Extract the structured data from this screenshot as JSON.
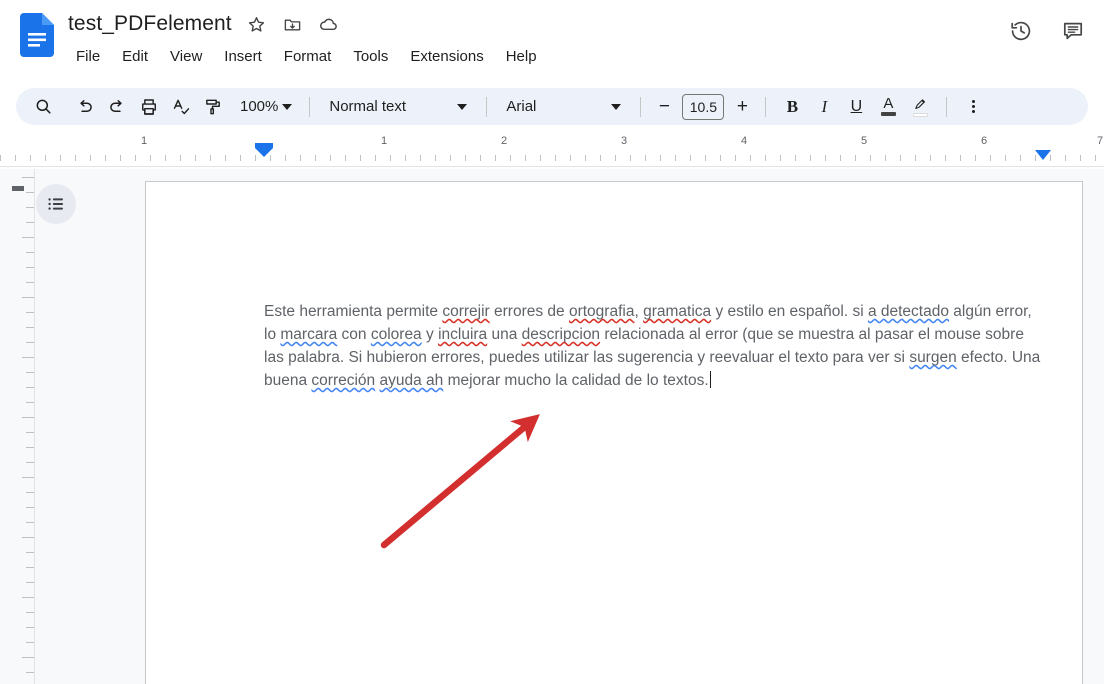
{
  "header": {
    "doc_title": "test_PDFelement",
    "logo_name": "google-docs-logo",
    "title_icons": [
      {
        "name": "star-icon",
        "label": "Star"
      },
      {
        "name": "move-to-folder-icon",
        "label": "Move"
      },
      {
        "name": "cloud-saved-icon",
        "label": "Saved to Drive"
      }
    ],
    "menu": [
      {
        "label": "File"
      },
      {
        "label": "Edit"
      },
      {
        "label": "View"
      },
      {
        "label": "Insert"
      },
      {
        "label": "Format"
      },
      {
        "label": "Tools"
      },
      {
        "label": "Extensions"
      },
      {
        "label": "Help"
      }
    ],
    "right_icons": [
      {
        "name": "version-history-icon",
        "label": "Last edit"
      },
      {
        "name": "comment-icon",
        "label": "Open comment history"
      }
    ]
  },
  "toolbar": {
    "background": "#edf2fa",
    "search_label": "Search",
    "undo_label": "Undo",
    "redo_label": "Redo",
    "print_label": "Print",
    "spellcheck_label": "Spelling and grammar check",
    "paint_format_label": "Paint format",
    "zoom_value": "100%",
    "style_value": "Normal text",
    "font_value": "Arial",
    "font_size_value": "10.5",
    "decrease_font_label": "−",
    "increase_font_label": "+",
    "bold_label": "B",
    "italic_label": "I",
    "underline_label": "U",
    "text_color_label": "A",
    "text_color_swatch": "#434343",
    "highlight_label": "Highlight color",
    "highlight_swatch": "#ffffff",
    "more_label": "More"
  },
  "ruler": {
    "numbers": [
      "1",
      "1",
      "2",
      "3",
      "4",
      "5",
      "6",
      "7"
    ],
    "left_indent_label": "Left indent",
    "right_indent_label": "Right indent"
  },
  "workspace": {
    "outline_button_label": "Show document outline",
    "background": "#f8f9fa"
  },
  "document": {
    "paragraph_segments": [
      {
        "text": "Este herramienta permite ",
        "mark": "none"
      },
      {
        "text": "correjir",
        "mark": "spelling"
      },
      {
        "text": " errores de ",
        "mark": "none"
      },
      {
        "text": "ortografia",
        "mark": "spelling"
      },
      {
        "text": ", ",
        "mark": "none"
      },
      {
        "text": "gramatica",
        "mark": "spelling"
      },
      {
        "text": " y estilo en español. si ",
        "mark": "none"
      },
      {
        "text": "a detectado",
        "mark": "grammar"
      },
      {
        "text": " algún error, lo ",
        "mark": "none"
      },
      {
        "text": "marcara",
        "mark": "grammar"
      },
      {
        "text": " con ",
        "mark": "none"
      },
      {
        "text": "colorea",
        "mark": "grammar"
      },
      {
        "text": " y ",
        "mark": "none"
      },
      {
        "text": "incluira",
        "mark": "spelling"
      },
      {
        "text": " una ",
        "mark": "none"
      },
      {
        "text": "descripcion",
        "mark": "spelling"
      },
      {
        "text": " relacionada al error (que se muestra al pasar el mouse sobre las palabra. Si hubieron errores, puedes utilizar las sugerencia y reevaluar el texto para ver si ",
        "mark": "none"
      },
      {
        "text": "surgen",
        "mark": "grammar"
      },
      {
        "text": " efecto. Una buena ",
        "mark": "none"
      },
      {
        "text": "correción",
        "mark": "grammar"
      },
      {
        "text": " ",
        "mark": "none"
      },
      {
        "text": "ayuda ah",
        "mark": "grammar"
      },
      {
        "text": " mejorar mucho la calidad de lo textos.",
        "mark": "none"
      }
    ],
    "spelling_underline_color": "#d93025",
    "grammar_underline_color": "#4285f4",
    "text_color": "#5f6368",
    "cursor_name": "text-cursor"
  },
  "annotation": {
    "arrow_color": "#d32f2f",
    "arrow_name": "red-pointer-arrow"
  }
}
